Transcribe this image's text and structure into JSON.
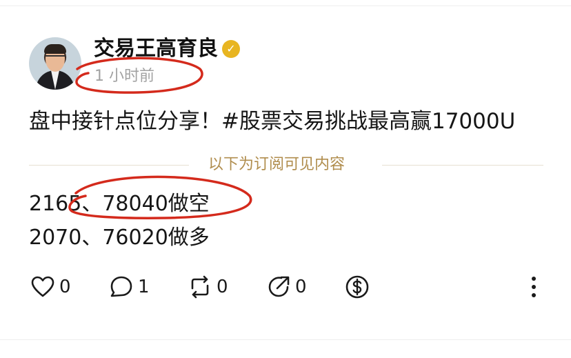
{
  "author": {
    "name": "交易王高育良",
    "verified": true,
    "verified_color": "#e8b521",
    "verified_icon": "check-icon",
    "time": "1 小时前"
  },
  "post": {
    "text": "盘中接针点位分享！#股票交易挑战最高赢17000U"
  },
  "divider": {
    "label": "以下为订阅可见内容",
    "color": "#b08d4d"
  },
  "content": {
    "lines": [
      "2165、78040做空",
      "2070、76020做多"
    ]
  },
  "actions": {
    "like_count": "0",
    "comment_count": "1",
    "repost_count": "0",
    "share_count": "0",
    "icons": [
      "heart-icon",
      "comment-icon",
      "repost-icon",
      "share-icon",
      "tip-dollar-icon",
      "more-vertical-icon"
    ]
  },
  "annotation_color": "#d42a1c"
}
